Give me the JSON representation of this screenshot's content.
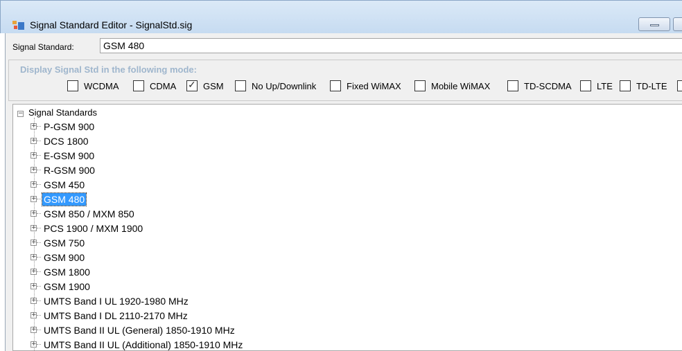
{
  "window": {
    "title": "Signal Standard Editor - SignalStd.sig"
  },
  "signal_standard": {
    "label": "Signal Standard:",
    "value": "GSM 480"
  },
  "display_mode": {
    "legend": "Display Signal Std in the following mode:",
    "options": [
      {
        "label": "WCDMA",
        "checked": false
      },
      {
        "label": "CDMA",
        "checked": false
      },
      {
        "label": "GSM",
        "checked": true
      },
      {
        "label": "No Up/Downlink",
        "checked": false
      },
      {
        "label": "Fixed WiMAX",
        "checked": false
      },
      {
        "label": "Mobile WiMAX",
        "checked": false
      },
      {
        "label": "TD-SCDMA",
        "checked": false
      },
      {
        "label": "LTE",
        "checked": false
      },
      {
        "label": "TD-LTE",
        "checked": false
      }
    ]
  },
  "tree": {
    "root_label": "Signal Standards",
    "items": [
      {
        "label": "P-GSM 900"
      },
      {
        "label": "DCS 1800"
      },
      {
        "label": "E-GSM 900"
      },
      {
        "label": "R-GSM 900"
      },
      {
        "label": "GSM 450"
      },
      {
        "label": "GSM 480",
        "selected": true
      },
      {
        "label": "GSM 850 / MXM 850"
      },
      {
        "label": "PCS 1900 / MXM 1900"
      },
      {
        "label": "GSM 750"
      },
      {
        "label": "GSM 900"
      },
      {
        "label": "GSM 1800"
      },
      {
        "label": "GSM 1900"
      },
      {
        "label": "UMTS Band I UL 1920-1980 MHz"
      },
      {
        "label": "UMTS Band I DL 2110-2170 MHz"
      },
      {
        "label": "UMTS Band II UL (General) 1850-1910 MHz"
      },
      {
        "label": "UMTS Band II UL (Additional) 1850-1910 MHz"
      }
    ]
  }
}
